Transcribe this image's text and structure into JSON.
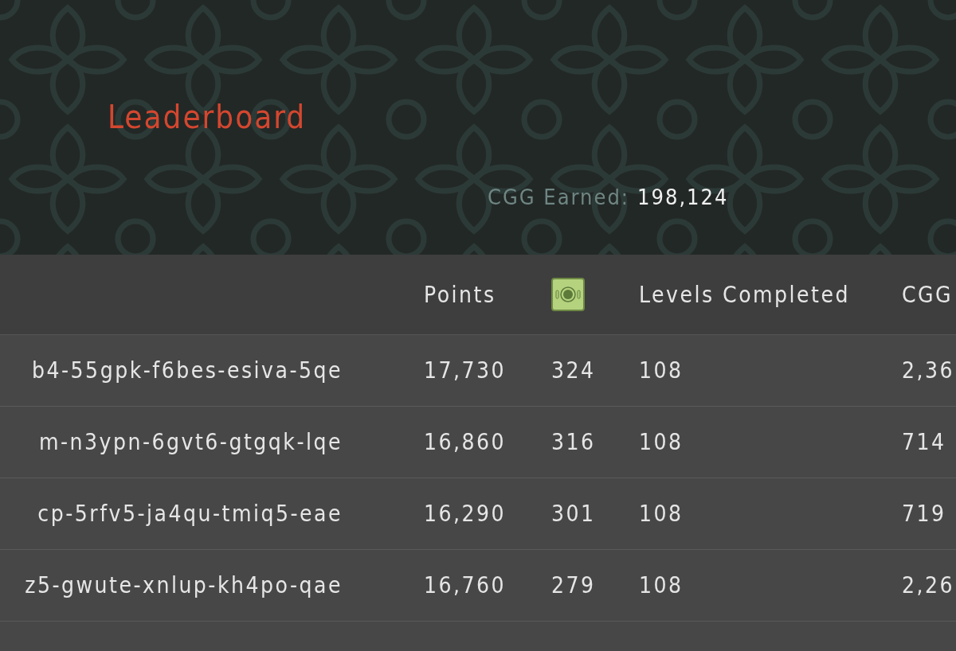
{
  "title": "Leaderboard",
  "earned": {
    "label": "CGG Earned:",
    "value": "198,124"
  },
  "table": {
    "columns": [
      {
        "kind": "text"
      },
      {
        "kind": "text",
        "label": "Points"
      },
      {
        "kind": "icon"
      },
      {
        "kind": "text",
        "label": "Levels Completed"
      },
      {
        "kind": "text",
        "label": "CGG"
      }
    ],
    "rows": [
      {
        "cells": [
          "b4-55gpk-f6bes-esiva-5qe",
          "17,730",
          "324",
          "108",
          "2,36"
        ]
      },
      {
        "cells": [
          "m-n3ypn-6gvt6-gtgqk-lqe",
          "16,860",
          "316",
          "108",
          "714"
        ]
      },
      {
        "cells": [
          "cp-5rfv5-ja4qu-tmiq5-eae",
          "16,290",
          "301",
          "108",
          "719"
        ]
      },
      {
        "cells": [
          "z5-gwute-xnlup-kh4po-qae",
          "16,760",
          "279",
          "108",
          "2,26"
        ]
      }
    ]
  }
}
